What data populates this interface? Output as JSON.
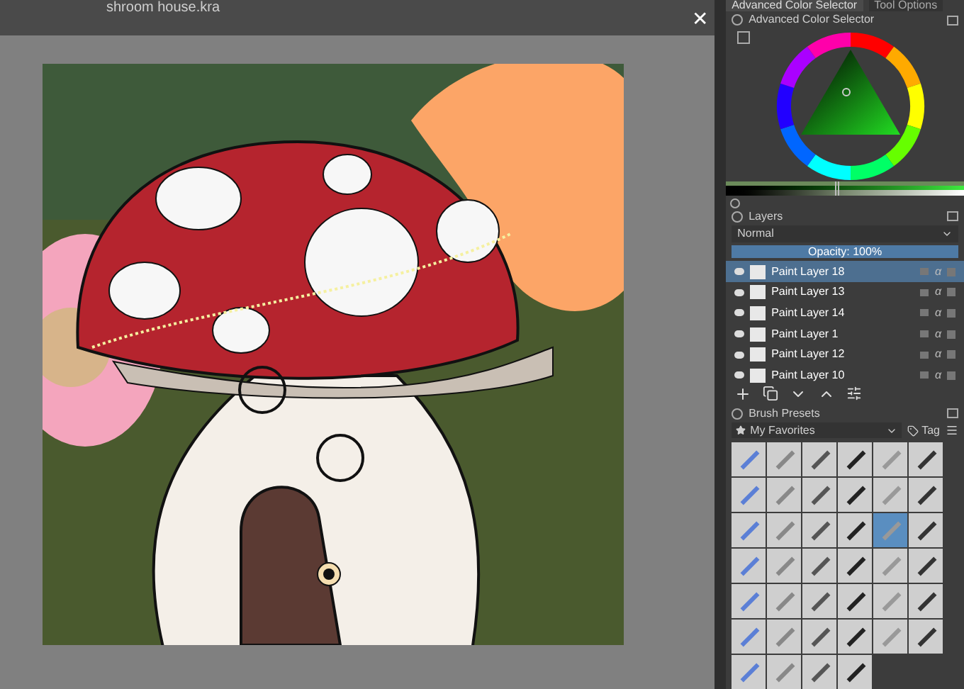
{
  "document": {
    "title": "shroom house.kra",
    "close": "✕"
  },
  "dock_tabs": [
    {
      "label": "Advanced Color Selector",
      "selected": true
    },
    {
      "label": "Tool Options",
      "selected": false
    }
  ],
  "color_selector": {
    "title": "Advanced Color Selector",
    "sliders": [
      {
        "level": 0.46
      },
      {
        "level": 0.46
      },
      {
        "level": 0.46
      }
    ]
  },
  "layers": {
    "title": "Layers",
    "blend_mode": "Normal",
    "opacity_slider": {
      "label": "Opacity:  100%",
      "level": 1
    },
    "items": [
      {
        "name": "Paint Layer 18",
        "alpha": "α",
        "selected": true
      },
      {
        "name": "Paint Layer 13",
        "alpha": "α",
        "selected": false
      },
      {
        "name": "Paint Layer 14",
        "alpha": "α",
        "selected": false
      },
      {
        "name": "Paint Layer 1",
        "alpha": "α",
        "selected": false
      },
      {
        "name": "Paint Layer 12",
        "alpha": "α",
        "selected": false
      },
      {
        "name": "Paint Layer 10",
        "alpha": "α",
        "selected": false
      }
    ]
  },
  "brush_presets": {
    "title": "Brush Presets",
    "tag_filter": "My Favorites",
    "tag_button": "Tag",
    "presets": [
      {
        "selected": false
      },
      {
        "selected": false
      },
      {
        "selected": false
      },
      {
        "selected": false
      },
      {
        "selected": false
      },
      {
        "selected": false
      },
      {
        "selected": false
      },
      {
        "selected": false
      },
      {
        "selected": false
      },
      {
        "selected": false
      },
      {
        "selected": false
      },
      {
        "selected": false
      },
      {
        "selected": false
      },
      {
        "selected": false
      },
      {
        "selected": false
      },
      {
        "selected": false
      },
      {
        "selected": true
      },
      {
        "selected": false
      },
      {
        "selected": false
      },
      {
        "selected": false
      },
      {
        "selected": false
      },
      {
        "selected": false
      },
      {
        "selected": false
      },
      {
        "selected": false
      },
      {
        "selected": false
      },
      {
        "selected": false
      },
      {
        "selected": false
      },
      {
        "selected": false
      },
      {
        "selected": false
      },
      {
        "selected": false
      },
      {
        "selected": false
      },
      {
        "selected": false
      },
      {
        "selected": false
      },
      {
        "selected": false
      },
      {
        "selected": false
      },
      {
        "selected": false
      },
      {
        "selected": false
      },
      {
        "selected": false
      },
      {
        "selected": false
      },
      {
        "selected": false
      }
    ]
  }
}
